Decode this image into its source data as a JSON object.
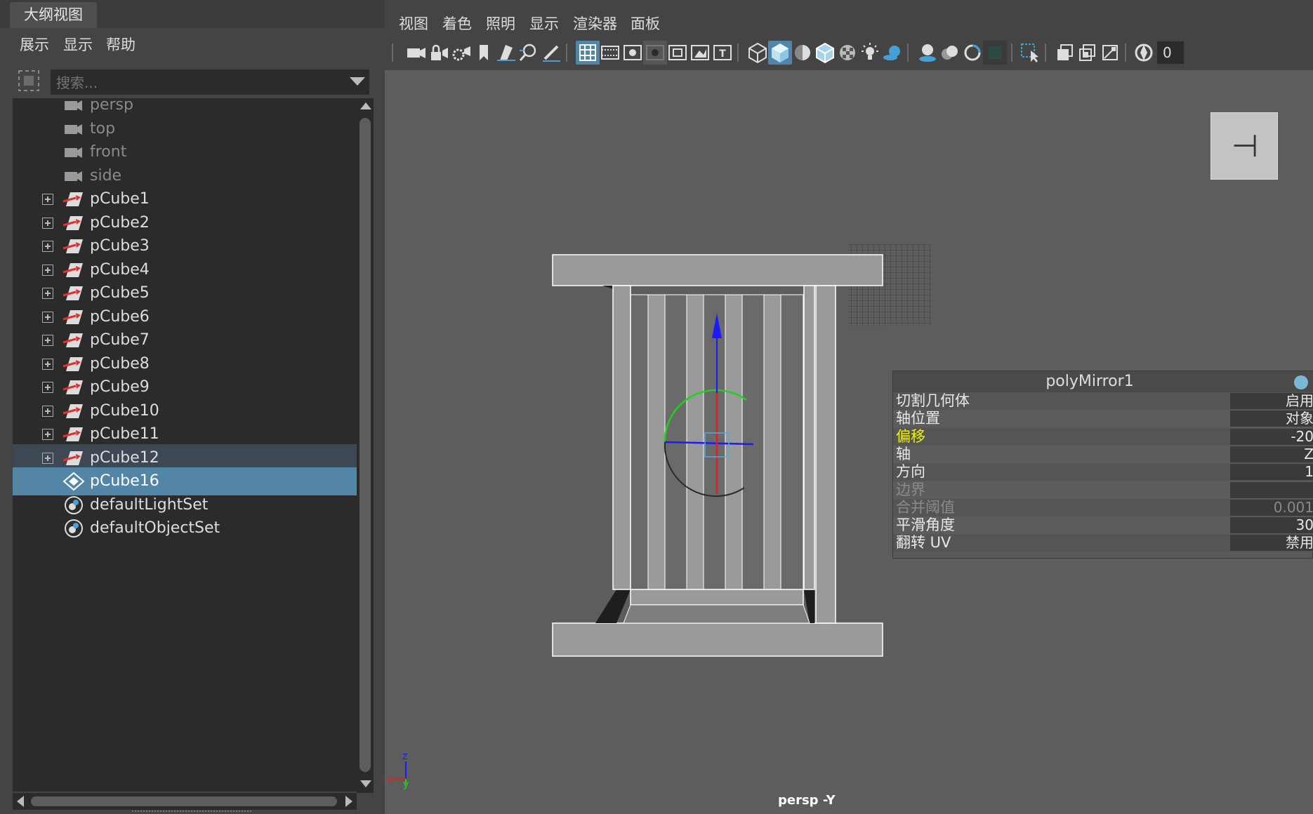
{
  "outliner": {
    "tab_title": "大纲视图",
    "menu": [
      "展示",
      "显示",
      "帮助"
    ],
    "search_placeholder": "搜索...",
    "items": [
      {
        "label": "persp",
        "type": "camera"
      },
      {
        "label": "top",
        "type": "camera"
      },
      {
        "label": "front",
        "type": "camera"
      },
      {
        "label": "side",
        "type": "camera"
      },
      {
        "label": "pCube1",
        "type": "mesh"
      },
      {
        "label": "pCube2",
        "type": "mesh"
      },
      {
        "label": "pCube3",
        "type": "mesh"
      },
      {
        "label": "pCube4",
        "type": "mesh"
      },
      {
        "label": "pCube5",
        "type": "mesh"
      },
      {
        "label": "pCube6",
        "type": "mesh"
      },
      {
        "label": "pCube7",
        "type": "mesh"
      },
      {
        "label": "pCube8",
        "type": "mesh"
      },
      {
        "label": "pCube9",
        "type": "mesh"
      },
      {
        "label": "pCube10",
        "type": "mesh"
      },
      {
        "label": "pCube11",
        "type": "mesh"
      },
      {
        "label": "pCube12",
        "type": "mesh",
        "state": "highlighted"
      },
      {
        "label": "pCube16",
        "type": "polymesh",
        "state": "selected"
      },
      {
        "label": "defaultLightSet",
        "type": "set"
      },
      {
        "label": "defaultObjectSet",
        "type": "set"
      }
    ]
  },
  "viewport": {
    "menu": [
      "视图",
      "着色",
      "照明",
      "显示",
      "渲染器",
      "面板"
    ],
    "toolbar_field": "0",
    "camera_label": "persp -Y",
    "axis_labels": {
      "z": "z",
      "x": "x",
      "y": "y"
    },
    "viewcube_glyph": "⊣"
  },
  "channel_box": {
    "title": "polyMirror1",
    "rows": [
      {
        "name": "切割几何体",
        "value": "启用",
        "state": "normal"
      },
      {
        "name": "轴位置",
        "value": "对象",
        "state": "normal"
      },
      {
        "name": "偏移",
        "value": "-20",
        "state": "highlighted"
      },
      {
        "name": "轴",
        "value": "Z",
        "state": "normal"
      },
      {
        "name": "方向",
        "value": "1",
        "state": "normal"
      },
      {
        "name": "边界",
        "value": "",
        "state": "disabled"
      },
      {
        "name": "合并阈值",
        "value": "0.001",
        "state": "disabled"
      },
      {
        "name": "平滑角度",
        "value": "30",
        "state": "normal"
      },
      {
        "name": "翻转 UV",
        "value": "禁用",
        "state": "normal"
      }
    ]
  },
  "colors": {
    "selection": "#5285a6",
    "highlight_attribute": "#f2f200",
    "manipulator_x": "#e02020",
    "manipulator_y": "#20d020",
    "manipulator_z": "#1a1aff"
  }
}
